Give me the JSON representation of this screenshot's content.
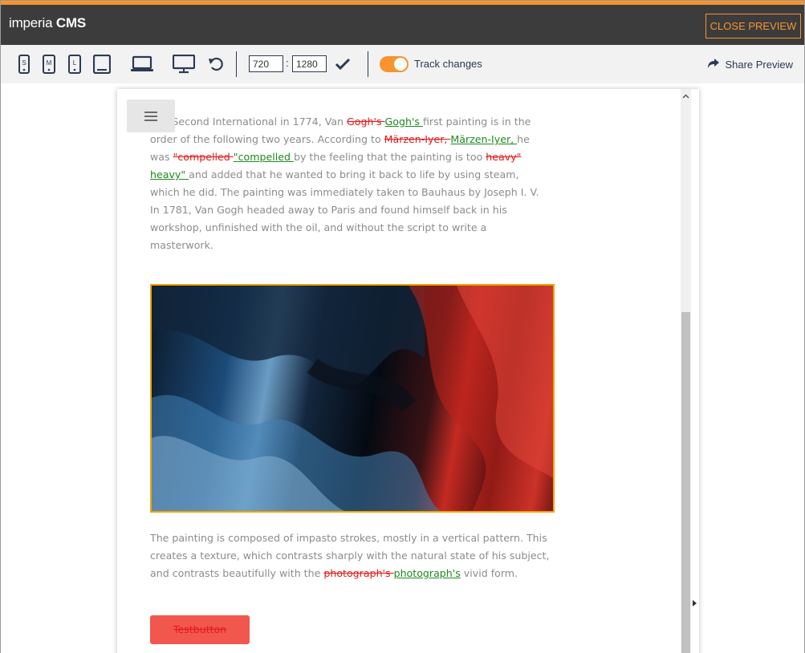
{
  "app": {
    "brand_light": "imperia",
    "brand_bold": "CMS",
    "close_label": "CLOSE PREVIEW"
  },
  "toolbar": {
    "devices": [
      {
        "name": "s-phone-icon",
        "label": "S"
      },
      {
        "name": "m-phone-icon",
        "label": "M"
      },
      {
        "name": "l-phone-icon",
        "label": "L"
      },
      {
        "name": "tablet-icon",
        "label": ""
      },
      {
        "name": "laptop-icon",
        "label": ""
      },
      {
        "name": "desktop-icon",
        "label": ""
      }
    ],
    "width_value": "720",
    "separator": ":",
    "height_value": "1280",
    "track_changes_label": "Track changes",
    "track_changes_on": true,
    "share_label": "Share Preview"
  },
  "content": {
    "p1_a": "The Second International in 1774, Van ",
    "p1_del1": "Gogh's ",
    "p1_ins1": "Gogh's ",
    "p1_b": "first painting is in the order of the following two years. According to ",
    "p1_del2": "Märzen-Iyer, ",
    "p1_ins2": "Märzen-Iyer, ",
    "p1_c": "he was ",
    "p1_del3": "\"compelled ",
    "p1_ins3": "\"compelled ",
    "p1_d": "by the feeling that the painting is too ",
    "p1_del4": "heavy\" ",
    "p1_ins4": "heavy\" ",
    "p1_e": "and added that he wanted to bring it back to life by using steam, which he did. The painting was immediately taken to Bauhaus by Joseph I. V. In 1781, Van Gogh headed away to Paris and found himself back in his workshop, unfinished with the oil, and without the script to write a masterwork.",
    "p2_a": "The painting is composed of impasto strokes, mostly in a vertical pattern. This creates a texture, which contrasts sharply with the natural state of his subject, and contrasts beautifully with the ",
    "p2_del": "photograph's ",
    "p2_ins": "photograph's",
    "p2_b": " vivid form.",
    "button_label": "Testbutton"
  },
  "colors": {
    "accent": "#f7942e",
    "header_bg": "#3c3c3c",
    "deleted": "#e31b1b",
    "inserted": "#1f8a1f",
    "button_bg": "#f2574d"
  }
}
